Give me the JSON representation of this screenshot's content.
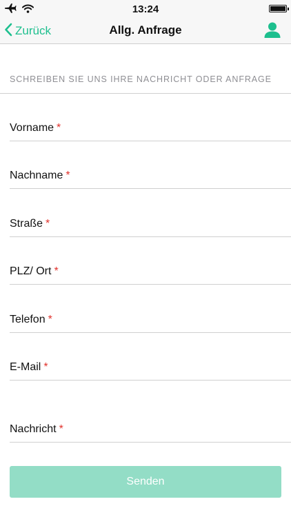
{
  "status_bar": {
    "time": "13:24",
    "icons": [
      "airplane-icon",
      "wifi-icon",
      "battery-icon"
    ]
  },
  "nav": {
    "back_label": "Zurück",
    "title": "Allg. Anfrage",
    "right_icon": "person-icon"
  },
  "form": {
    "section_header": "SCHREIBEN SIE UNS IHRE NACHRICHT ODER ANFRAGE",
    "required_marker": "*",
    "fields": [
      {
        "label": "Vorname"
      },
      {
        "label": "Nachname"
      },
      {
        "label": "Straße"
      },
      {
        "label": "PLZ/ Ort"
      },
      {
        "label": "Telefon"
      },
      {
        "label": "E-Mail"
      },
      {
        "label": "Nachricht"
      }
    ],
    "submit_label": "Senden"
  },
  "colors": {
    "accent": "#1dbf8e",
    "button_disabled": "#93ddc6",
    "required": "#e1322c",
    "section_header": "#8e8e93",
    "divider": "#cfcfcf"
  }
}
